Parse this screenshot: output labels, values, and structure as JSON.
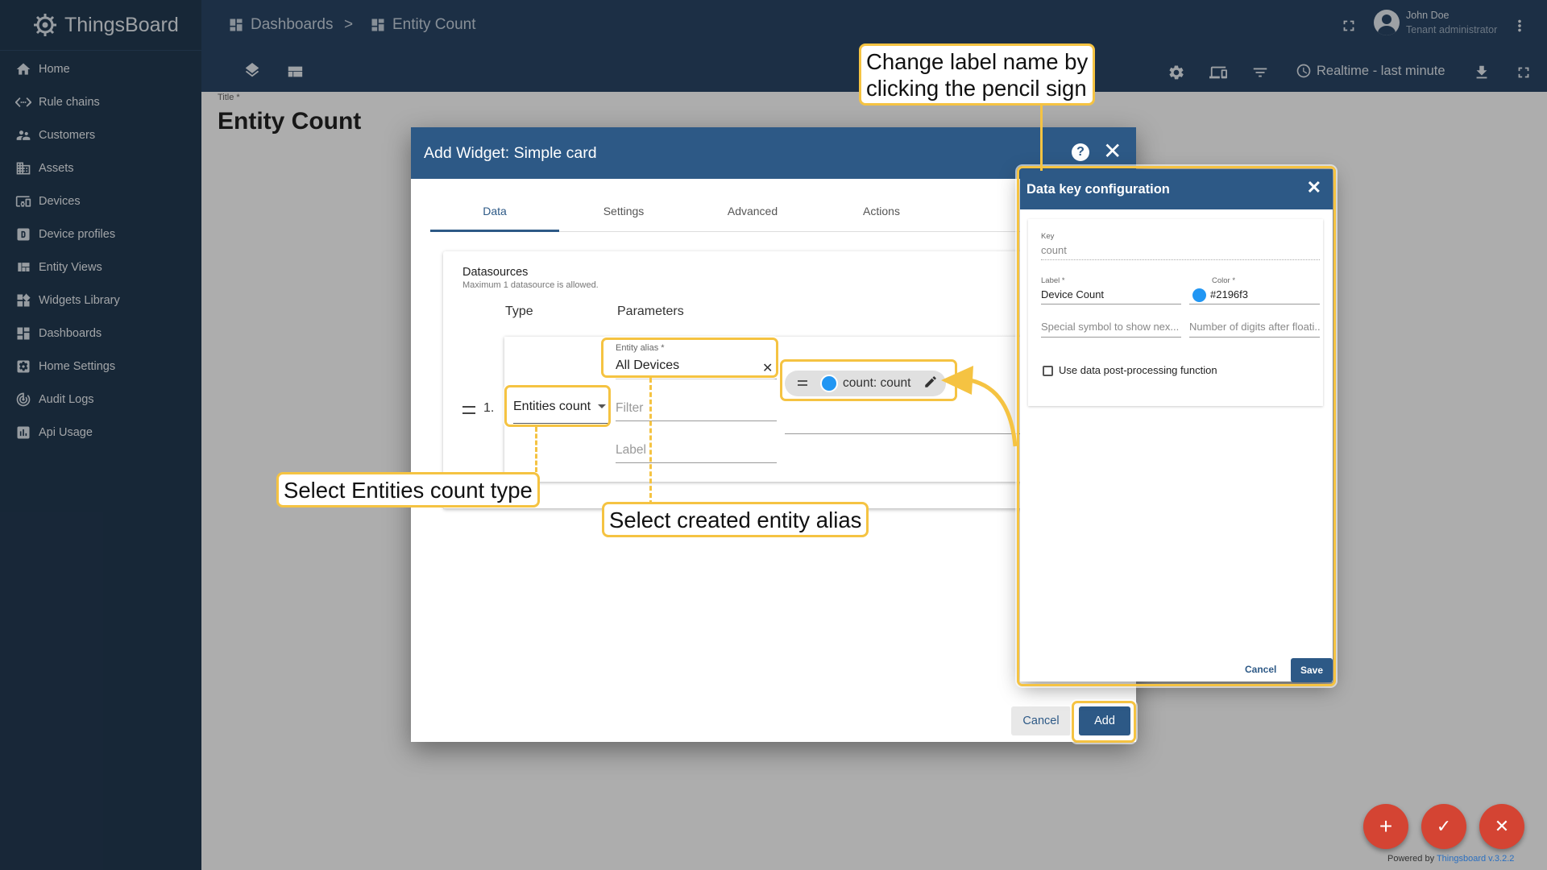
{
  "brand": {
    "name": "ThingsBoard"
  },
  "sidebar": {
    "items": [
      {
        "label": "Home",
        "icon": "home-icon"
      },
      {
        "label": "Rule chains",
        "icon": "settings-ethernet-icon"
      },
      {
        "label": "Customers",
        "icon": "supervisor-account-icon"
      },
      {
        "label": "Assets",
        "icon": "domain-icon"
      },
      {
        "label": "Devices",
        "icon": "devices-other-icon"
      },
      {
        "label": "Device profiles",
        "icon": "device-profile-icon"
      },
      {
        "label": "Entity Views",
        "icon": "view-quilt-icon"
      },
      {
        "label": "Widgets Library",
        "icon": "widgets-icon"
      },
      {
        "label": "Dashboards",
        "icon": "dashboard-icon"
      },
      {
        "label": "Home Settings",
        "icon": "settings-applications-icon"
      },
      {
        "label": "Audit Logs",
        "icon": "track-changes-icon"
      },
      {
        "label": "Api Usage",
        "icon": "insert-chart-icon"
      }
    ]
  },
  "header": {
    "breadcrumb": [
      {
        "label": "Dashboards"
      },
      {
        "label": "Entity Count"
      }
    ],
    "separator": ">",
    "user_name": "John Doe",
    "user_role": "Tenant administrator",
    "timewindow": "Realtime - last minute"
  },
  "dashboard": {
    "title_caption": "Title *",
    "title": "Entity Count"
  },
  "widget_dialog": {
    "title": "Add Widget: Simple card",
    "help": "?",
    "close": "✕",
    "tabs": [
      {
        "label": "Data"
      },
      {
        "label": "Settings"
      },
      {
        "label": "Advanced"
      },
      {
        "label": "Actions"
      }
    ],
    "datasources_title": "Datasources",
    "datasources_hint": "Maximum 1 datasource is allowed.",
    "col_type": "Type",
    "col_params": "Parameters",
    "row_number": "1.",
    "type_value": "Entities count",
    "alias_label": "Entity alias *",
    "alias_value": "All Devices",
    "alias_clear": "✕",
    "filter_placeholder": "Filter",
    "label_placeholder": "Label",
    "data_key_chip": "count: count",
    "cancel": "Cancel",
    "add": "Add"
  },
  "data_key_dialog": {
    "title": "Data key configuration",
    "close": "✕",
    "key_label": "Key",
    "key_value": "count",
    "label_label": "Label *",
    "label_value": "Device Count",
    "color_label": "Color *",
    "color_value": "#2196f3",
    "special_symbol_placeholder": "Special symbol to show nex...",
    "decimals_placeholder": "Number of digits after floati...",
    "post_processing_label": "Use data post-processing function",
    "cancel": "Cancel",
    "save": "Save"
  },
  "callouts": {
    "pencil": "Change label name by\nclicking the pencil sign",
    "type": "Select Entities count type",
    "alias": "Select created entity alias"
  },
  "footer": {
    "powered_by": "Powered by",
    "version_link": "Thingsboard v.3.2.2"
  },
  "fabs": {
    "add": "+",
    "apply": "✓",
    "cancel": "✕"
  },
  "colors": {
    "sidebar": "#233a52",
    "topbar": "#2a4666",
    "primary": "#2d5986",
    "callout": "#f5c342",
    "fab": "#d44433",
    "key_color": "#2196f3"
  }
}
